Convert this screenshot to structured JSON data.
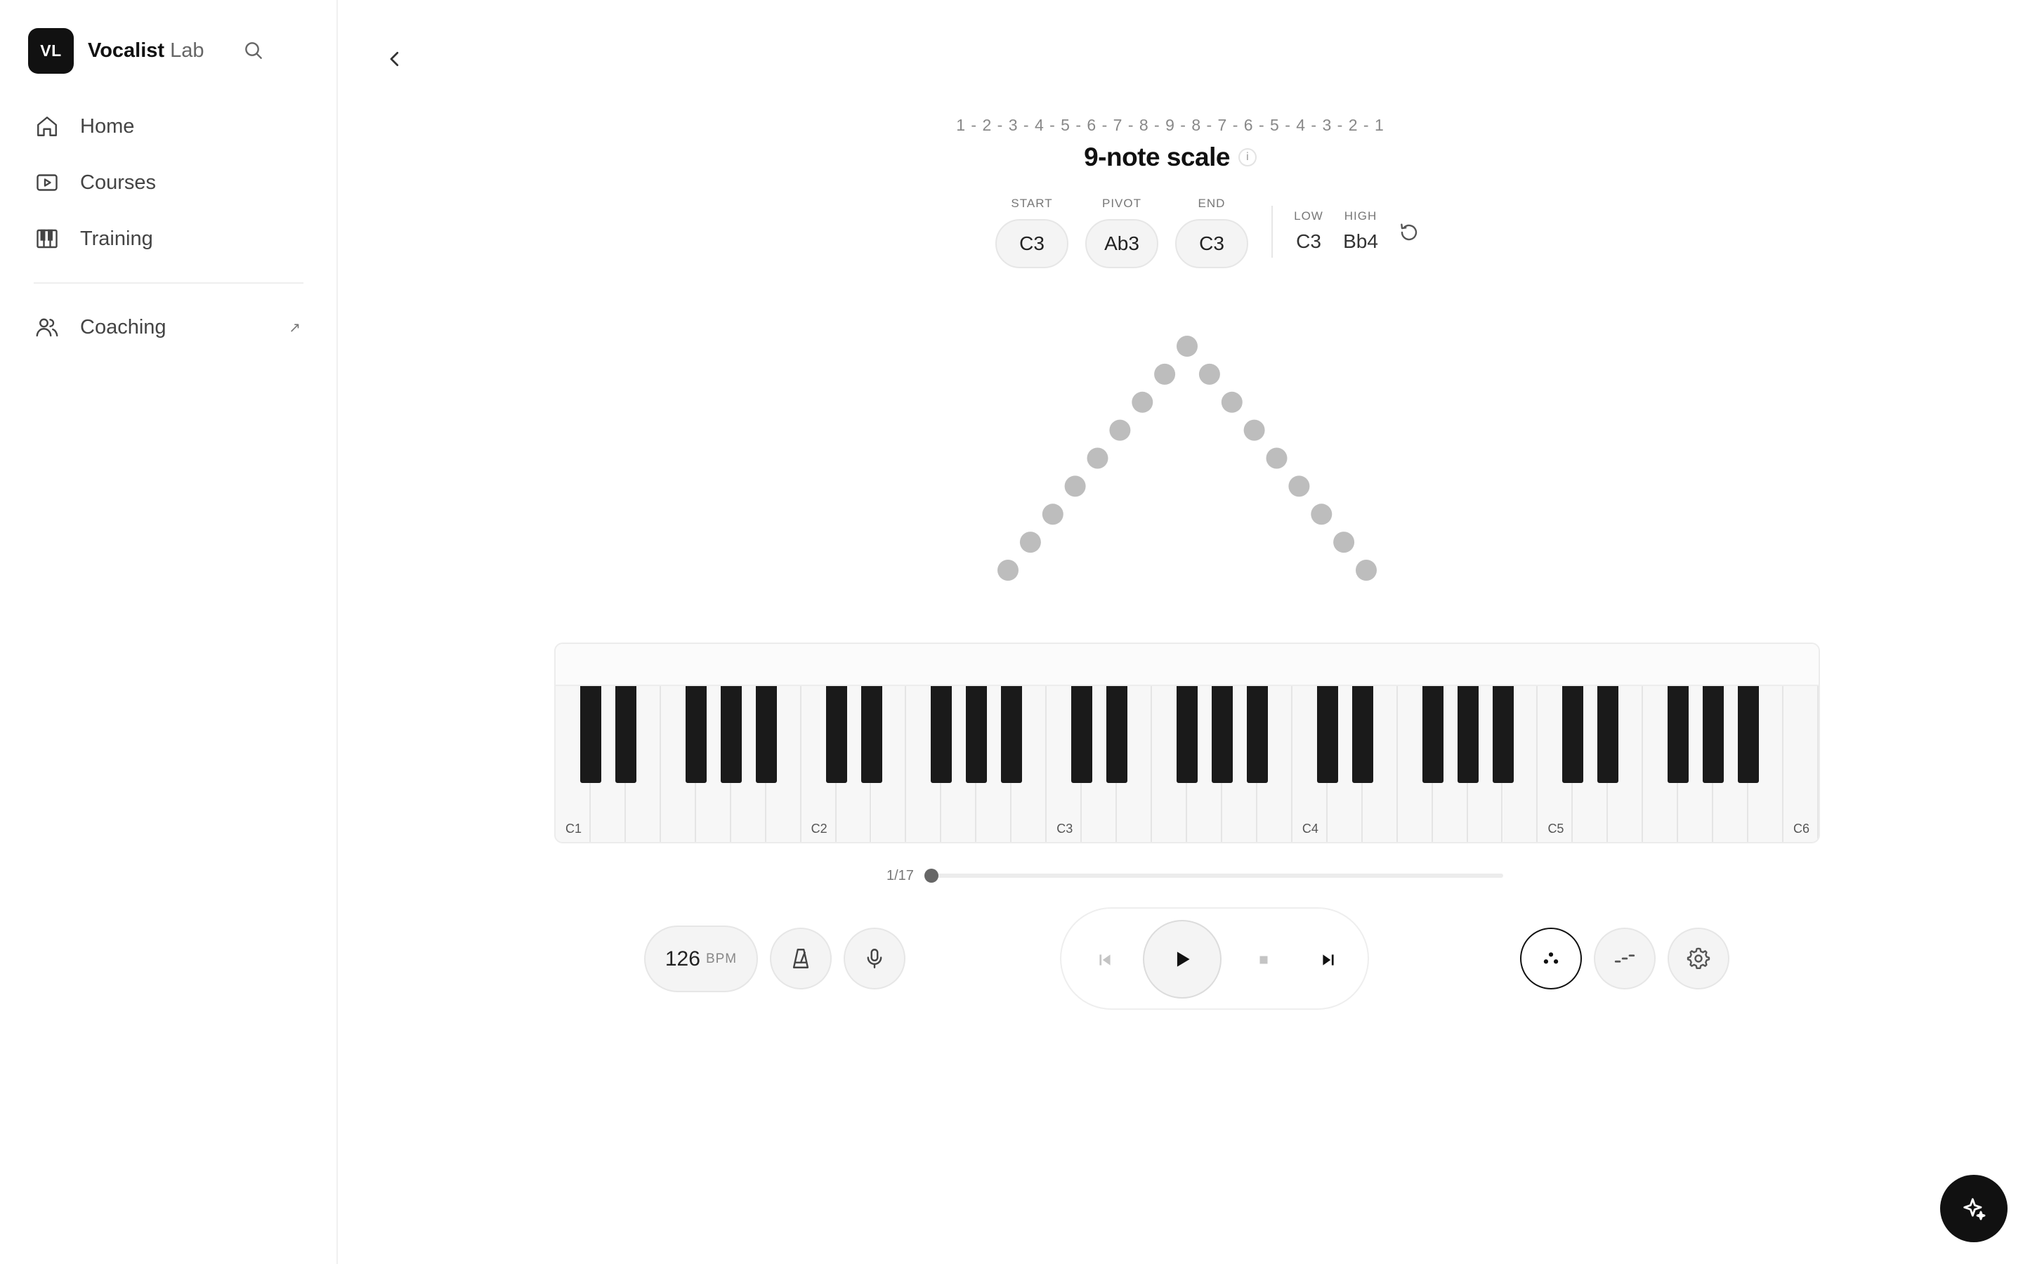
{
  "brand": {
    "logo_text": "VL",
    "name": "Vocalist",
    "suffix": "Lab"
  },
  "sidebar": {
    "items": [
      {
        "label": "Home",
        "icon": "home-icon"
      },
      {
        "label": "Courses",
        "icon": "play-square-icon"
      },
      {
        "label": "Training",
        "icon": "piano-icon"
      }
    ],
    "secondary": [
      {
        "label": "Coaching",
        "icon": "users-icon",
        "external_icon": "↗"
      }
    ]
  },
  "exercise": {
    "pattern": "1 - 2 - 3 - 4 - 5 - 6 - 7 - 8 - 9 - 8 - 7 - 6 - 5 - 4 - 3 - 2 - 1",
    "title": "9-note scale",
    "info_label": "i",
    "start": {
      "label": "START",
      "value": "C3"
    },
    "pivot": {
      "label": "PIVOT",
      "value": "Ab3"
    },
    "end": {
      "label": "END",
      "value": "C3"
    },
    "low": {
      "label": "LOW",
      "value": "C3"
    },
    "high": {
      "label": "HIGH",
      "value": "Bb4"
    },
    "contour": [
      1,
      2,
      3,
      4,
      5,
      6,
      7,
      8,
      9,
      8,
      7,
      6,
      5,
      4,
      3,
      2,
      1
    ],
    "dot_color": "#bdbdbd"
  },
  "piano": {
    "octave_labels": [
      "C1",
      "C2",
      "C3",
      "C4",
      "C5",
      "C6"
    ],
    "white_key_count": 36
  },
  "progress": {
    "label": "1/17",
    "current": 1,
    "total": 17
  },
  "controls": {
    "bpm_value": "126",
    "bpm_unit": "BPM"
  },
  "colors": {
    "accent": "#111111",
    "surface": "#f4f4f4",
    "border": "#e6e6e6"
  }
}
